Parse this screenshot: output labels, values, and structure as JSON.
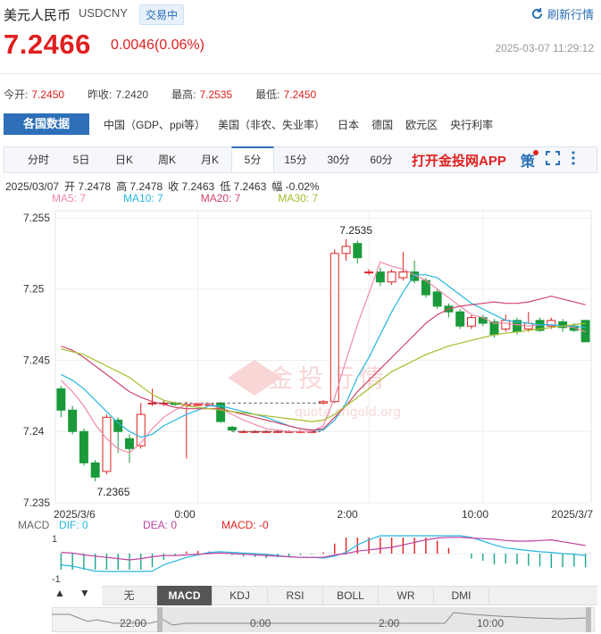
{
  "header": {
    "name": "美元人民币",
    "code": "USDCNY",
    "badge": "交易中",
    "refresh": "刷新行情",
    "price": "7.2466",
    "change": "0.0046(0.06%)",
    "timestamp": "2025-03-07 11:29:12"
  },
  "quote": {
    "open_label": "今开:",
    "open": "7.2450",
    "prev_label": "昨收:",
    "prev": "7.2420",
    "high_label": "最高:",
    "high": "7.2535",
    "low_label": "最低:",
    "low": "7.2450"
  },
  "country_tabs": [
    "各国数据",
    "中国（GDP、ppi等）",
    "美国（非农、失业率）",
    "日本",
    "德国",
    "欧元区",
    "央行利率"
  ],
  "period_tabs": [
    "分时",
    "5日",
    "日K",
    "周K",
    "月K",
    "5分",
    "15分",
    "30分",
    "60分"
  ],
  "active_period": "5分",
  "app_cta": "打开金投网APP",
  "strategy_icon": "策",
  "ohlc": {
    "date": "2025/03/07",
    "open": "开 7.2478",
    "high": "高 7.2478",
    "close": "收 7.2463",
    "low": "低 7.2463",
    "amp": "幅 -0.02%"
  },
  "ma_legend": [
    {
      "label": "MA5: 7",
      "color": "#f08aa8"
    },
    {
      "label": "MA10: 7",
      "color": "#26b6e0"
    },
    {
      "label": "MA20: 7",
      "color": "#d0466a"
    },
    {
      "label": "MA30: 7",
      "color": "#a6bb2a"
    }
  ],
  "watermark": "金投行情",
  "watermark_url": "quote.cngold.org",
  "colors": {
    "up": "#e02020",
    "down": "#1a9a3a",
    "accent": "#2d6fb8"
  },
  "chart_data": {
    "type": "line",
    "y_ticks": [
      "7.255",
      "7.25",
      "7.245",
      "7.24",
      "7.235"
    ],
    "x_ticks": [
      "2025/3/6",
      "0:00",
      "2:00",
      "10:00",
      "2025/3/7"
    ],
    "ylim": [
      7.235,
      7.2555
    ],
    "annotations": [
      {
        "label": "7.2535",
        "value": 7.2535
      },
      {
        "label": "7.2365",
        "value": 7.2365
      }
    ],
    "candles": [
      [
        7.243,
        7.2415,
        7.2432,
        7.241
      ],
      [
        7.2415,
        7.24,
        7.2418,
        7.2398
      ],
      [
        7.24,
        7.2378,
        7.2402,
        7.2376
      ],
      [
        7.2378,
        7.2368,
        7.238,
        7.2365
      ],
      [
        7.2372,
        7.241,
        7.2412,
        7.237
      ],
      [
        7.2408,
        7.24,
        7.241,
        7.2385
      ],
      [
        7.2395,
        7.2388,
        7.2398,
        7.2378
      ],
      [
        7.239,
        7.2412,
        7.242,
        7.2388
      ],
      [
        7.242,
        7.242,
        7.243,
        7.2418
      ],
      [
        7.242,
        7.242,
        7.2422,
        7.2418
      ],
      [
        7.242,
        7.2419,
        7.2421,
        7.2418
      ],
      [
        7.2419,
        7.2419,
        7.2421,
        7.2381
      ],
      [
        7.2419,
        7.2419,
        7.242,
        7.2418
      ],
      [
        7.2419,
        7.2419,
        7.242,
        7.2418
      ],
      [
        7.242,
        7.2407,
        7.2421,
        7.2406
      ],
      [
        7.2403,
        7.2401,
        7.2404,
        7.24
      ],
      [
        7.24,
        7.24,
        7.2401,
        7.2399
      ],
      [
        7.24,
        7.24,
        7.2401,
        7.2399
      ],
      [
        7.24,
        7.24,
        7.2401,
        7.2399
      ],
      [
        7.24,
        7.24,
        7.2401,
        7.2399
      ],
      [
        7.24,
        7.24,
        7.2401,
        7.2399
      ],
      [
        7.24,
        7.24,
        7.2401,
        7.2399
      ],
      [
        7.24,
        7.24,
        7.2401,
        7.2399
      ],
      [
        7.242,
        7.2421,
        7.2422,
        7.2419
      ],
      [
        7.2421,
        7.2525,
        7.2528,
        7.242
      ],
      [
        7.2525,
        7.253,
        7.2535,
        7.252
      ],
      [
        7.2532,
        7.2522,
        7.2534,
        7.2518
      ],
      [
        7.2512,
        7.2512,
        7.2514,
        7.251
      ],
      [
        7.2512,
        7.2505,
        7.2515,
        7.2502
      ],
      [
        7.2505,
        7.2512,
        7.2514,
        7.2503
      ],
      [
        7.2508,
        7.2512,
        7.2526,
        7.2506
      ],
      [
        7.2512,
        7.2506,
        7.252,
        7.2504
      ],
      [
        7.2506,
        7.2496,
        7.2508,
        7.2494
      ],
      [
        7.2498,
        7.2488,
        7.25,
        7.2486
      ],
      [
        7.2488,
        7.2484,
        7.249,
        7.248
      ],
      [
        7.2484,
        7.2474,
        7.2486,
        7.2472
      ],
      [
        7.2474,
        7.248,
        7.2482,
        7.2472
      ],
      [
        7.248,
        7.2476,
        7.2482,
        7.2474
      ],
      [
        7.2477,
        7.2468,
        7.2479,
        7.2466
      ],
      [
        7.2472,
        7.2478,
        7.2482,
        7.247
      ],
      [
        7.2478,
        7.247,
        7.248,
        7.2468
      ],
      [
        7.2472,
        7.2476,
        7.2484,
        7.247
      ],
      [
        7.2478,
        7.2471,
        7.248,
        7.247
      ],
      [
        7.2474,
        7.2478,
        7.248,
        7.2472
      ],
      [
        7.2477,
        7.2473,
        7.2479,
        7.247
      ],
      [
        7.2474,
        7.2471,
        7.2476,
        7.247
      ],
      [
        7.2478,
        7.2463,
        7.2478,
        7.2463
      ]
    ],
    "ma5": [
      7.2436,
      7.2428,
      7.2418,
      7.2405,
      7.2395,
      7.2388,
      7.2385,
      7.2392,
      7.2402,
      7.241,
      7.2415,
      7.2419,
      7.242,
      7.2419,
      7.2416,
      7.2412,
      7.2408,
      7.2405,
      7.2402,
      7.2401,
      7.24,
      7.24,
      7.24,
      7.2404,
      7.2424,
      7.245,
      7.2475,
      7.2497,
      7.2519,
      7.2516,
      7.2514,
      7.251,
      7.2506,
      7.25,
      7.2494,
      7.2488,
      7.2482,
      7.248,
      7.2476,
      7.2476,
      7.2475,
      7.2474,
      7.2475,
      7.2475,
      7.2474,
      7.2473,
      7.247
    ],
    "ma10": [
      7.244,
      7.2436,
      7.243,
      7.2422,
      7.2414,
      7.2406,
      7.24,
      7.2396,
      7.2398,
      7.2404,
      7.2408,
      7.2412,
      7.2415,
      7.2418,
      7.2418,
      7.2416,
      7.2414,
      7.2412,
      7.241,
      7.2407,
      7.2404,
      7.2402,
      7.2401,
      7.2401,
      7.2408,
      7.242,
      7.2438,
      7.2452,
      7.2468,
      7.2484,
      7.2498,
      7.251,
      7.251,
      7.2508,
      7.2502,
      7.2496,
      7.249,
      7.2486,
      7.2482,
      7.2478,
      7.2477,
      7.2476,
      7.2475,
      7.2475,
      7.2474,
      7.2474,
      7.2473
    ],
    "ma20": [
      7.246,
      7.2457,
      7.2452,
      7.2446,
      7.244,
      7.2434,
      7.2428,
      7.2424,
      7.2421,
      7.2419,
      7.2417,
      7.2416,
      7.2416,
      7.2416,
      7.2416,
      7.2414,
      7.2412,
      7.241,
      7.2408,
      7.2406,
      7.2404,
      7.2402,
      7.2401,
      7.2402,
      7.241,
      7.2418,
      7.2428,
      7.2436,
      7.2444,
      7.2452,
      7.246,
      7.2468,
      7.2476,
      7.2482,
      7.2486,
      7.2488,
      7.2489,
      7.249,
      7.2491,
      7.249,
      7.249,
      7.2491,
      7.2493,
      7.2495,
      7.2493,
      7.2491,
      7.2489
    ],
    "ma30": [
      7.2458,
      7.2456,
      7.2454,
      7.245,
      7.2446,
      7.2442,
      7.2438,
      7.2432,
      7.2426,
      7.2422,
      7.242,
      7.2418,
      7.2417,
      7.2416,
      7.2415,
      7.2414,
      7.2413,
      7.2412,
      7.2411,
      7.241,
      7.2409,
      7.2408,
      7.2407,
      7.2408,
      7.2412,
      7.2418,
      7.2424,
      7.243,
      7.2436,
      7.2442,
      7.2446,
      7.245,
      7.2454,
      7.2457,
      7.246,
      7.2462,
      7.2464,
      7.2466,
      7.2468,
      7.2469,
      7.247,
      7.2471,
      7.2472,
      7.2473,
      7.2474,
      7.2475,
      7.2476
    ]
  },
  "macd": {
    "label": "MACD",
    "dif": "DIF: 0",
    "dea": "DEA: 0",
    "macd": "MACD: -0",
    "dif_color": "#26b6e0",
    "dea_color": "#c040a0",
    "macd_color": "#e02020",
    "y_top": "1",
    "y_bottom": "-1"
  },
  "indicator_tabs": [
    "无",
    "MACD",
    "KDJ",
    "RSI",
    "BOLL",
    "WR",
    "DMI"
  ],
  "active_indicator": "MACD",
  "navigator": {
    "labels": [
      "22:00",
      "0:00",
      "2:00",
      "10:00"
    ]
  }
}
